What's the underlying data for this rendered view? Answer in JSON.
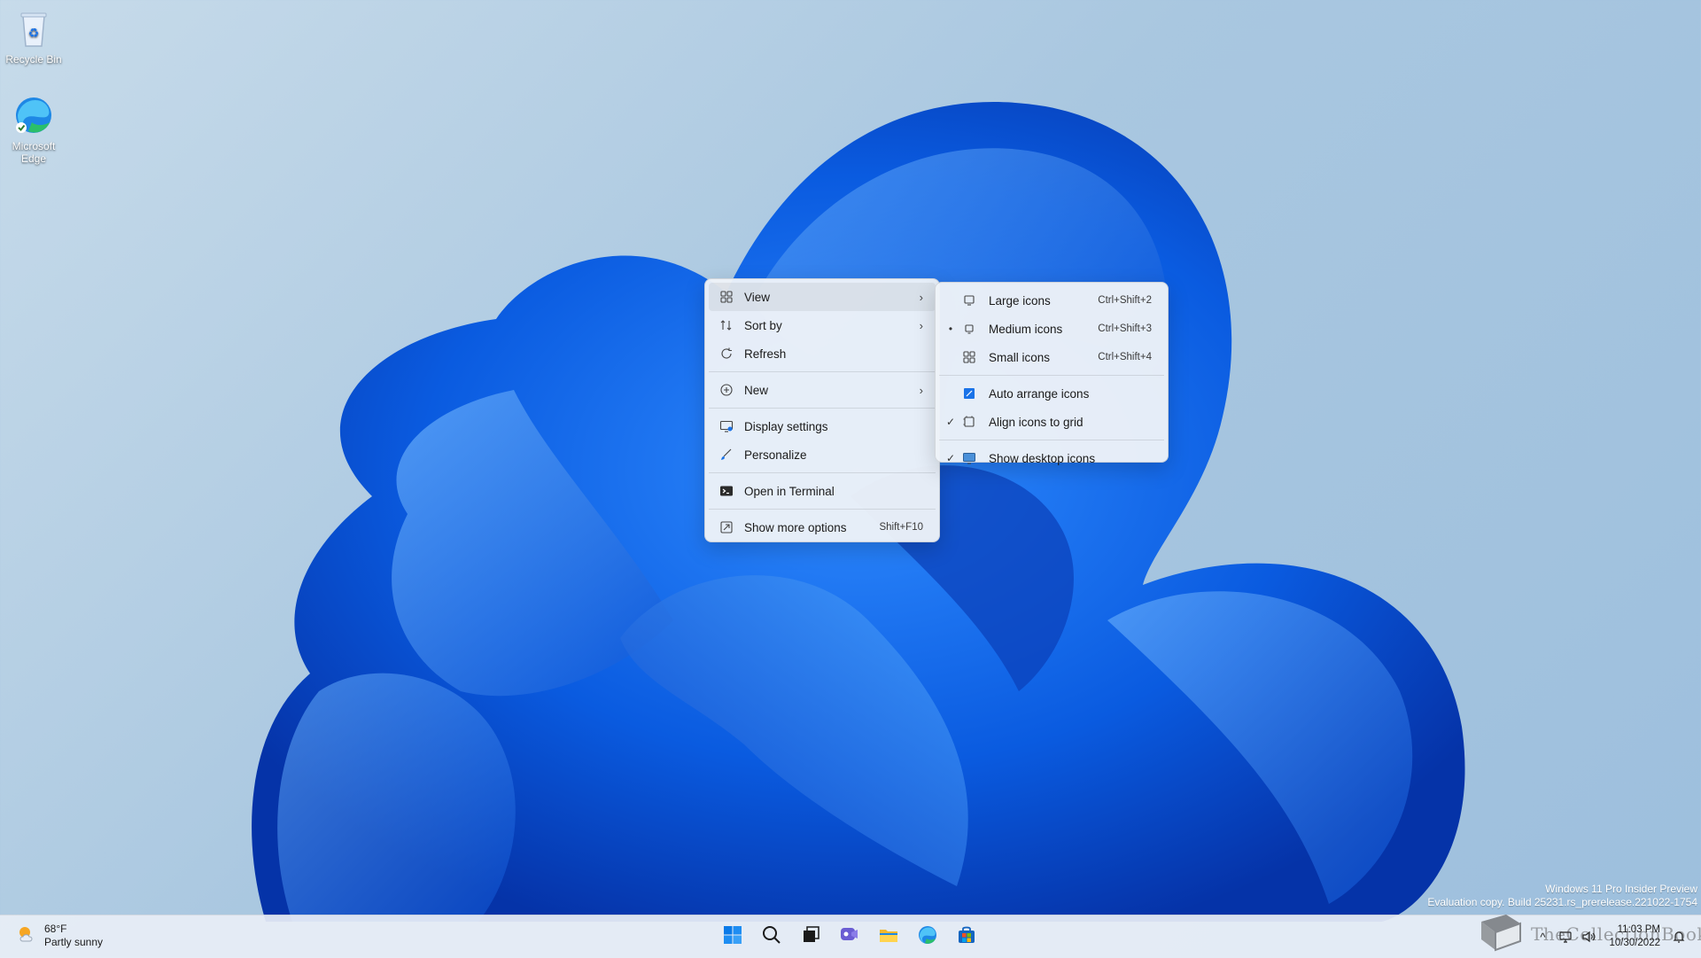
{
  "desktop": {
    "icons": [
      {
        "label": "Recycle Bin",
        "icon": "recycle-bin-icon"
      },
      {
        "label": "Microsoft Edge",
        "icon": "edge-icon"
      }
    ]
  },
  "context_menu": {
    "items": [
      {
        "label": "View",
        "icon": "grid-icon",
        "has_submenu": true
      },
      {
        "label": "Sort by",
        "icon": "sort-icon",
        "has_submenu": true
      },
      {
        "label": "Refresh",
        "icon": "refresh-icon"
      },
      {
        "label": "New",
        "icon": "plus-circle-icon",
        "has_submenu": true
      },
      {
        "label": "Display settings",
        "icon": "display-icon"
      },
      {
        "label": "Personalize",
        "icon": "brush-icon"
      },
      {
        "label": "Open in Terminal",
        "icon": "terminal-icon"
      },
      {
        "label": "Show more options",
        "icon": "more-options-icon",
        "shortcut": "Shift+F10"
      }
    ]
  },
  "view_submenu": {
    "items": [
      {
        "label": "Large icons",
        "shortcut": "Ctrl+Shift+2",
        "mark": ""
      },
      {
        "label": "Medium icons",
        "shortcut": "Ctrl+Shift+3",
        "mark": "•"
      },
      {
        "label": "Small icons",
        "shortcut": "Ctrl+Shift+4",
        "mark": ""
      },
      {
        "label": "Auto arrange icons",
        "mark": ""
      },
      {
        "label": "Align icons to grid",
        "mark": "✓"
      },
      {
        "label": "Show desktop icons",
        "mark": "✓"
      }
    ]
  },
  "watermark": {
    "line1": "Windows 11 Pro Insider Preview",
    "line2": "Evaluation copy. Build 25231.rs_prerelease.221022-1754"
  },
  "taskbar": {
    "weather": {
      "temp": "68°F",
      "condition": "Partly sunny"
    },
    "apps": [
      "start-icon",
      "search-icon",
      "task-view-icon",
      "chat-icon",
      "file-explorer-icon",
      "edge-icon",
      "store-icon"
    ],
    "clock": {
      "time": "11:03 PM",
      "date": "10/30/2022"
    },
    "overlay_text": "TheCollectionBook"
  },
  "colors": {
    "accent": "#0067c0",
    "menu_bg": "#eef2f8"
  }
}
